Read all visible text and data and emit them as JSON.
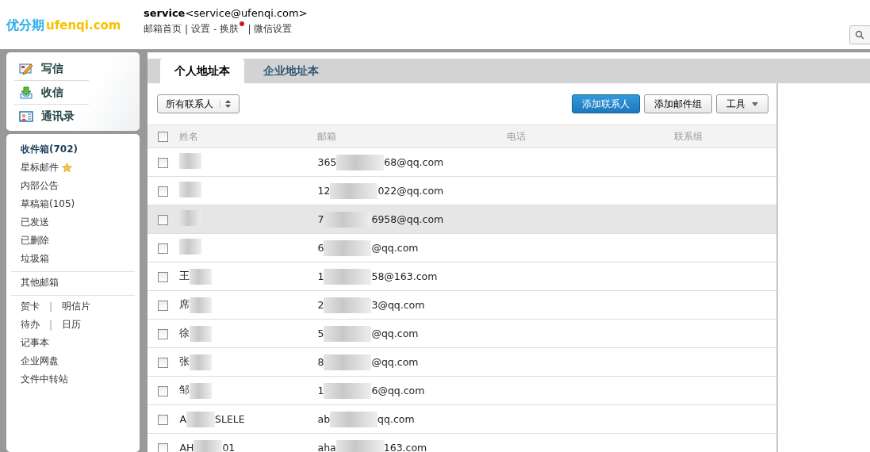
{
  "logo": {
    "name": "优分期",
    "domain": "ufenqi.com"
  },
  "account": {
    "user": "service",
    "address": "<service@ufenqi.com>"
  },
  "nav": [
    {
      "label": "邮箱首页",
      "sep": "|",
      "badge": false
    },
    {
      "label": "设置",
      "sep": "-",
      "badge": false
    },
    {
      "label": "换肤",
      "sep": "|",
      "badge": true
    },
    {
      "label": "微信设置",
      "badge": false
    }
  ],
  "quick_actions": [
    {
      "kind": "compose",
      "label": "写信"
    },
    {
      "kind": "receive",
      "label": "收信"
    },
    {
      "kind": "contacts",
      "label": "通讯录"
    }
  ],
  "folder_groups": [
    [
      {
        "label": "收件箱(702)",
        "selected": true,
        "starred": false
      },
      {
        "label": "星标邮件",
        "selected": false,
        "starred": true
      },
      {
        "label": "内部公告",
        "selected": false,
        "starred": false
      },
      {
        "label": "草稿箱(105)",
        "selected": false,
        "starred": false
      },
      {
        "label": "已发送",
        "selected": false,
        "starred": false
      },
      {
        "label": "已删除",
        "selected": false,
        "starred": false
      },
      {
        "label": "垃圾箱",
        "selected": false,
        "starred": false
      }
    ],
    [
      {
        "label": "其他邮箱",
        "selected": false,
        "starred": false
      }
    ],
    [
      {
        "links": [
          "贺卡",
          "明信片"
        ],
        "sep": "|"
      },
      {
        "links": [
          "待办",
          "日历"
        ],
        "sep": "|"
      },
      {
        "label": "记事本",
        "selected": false,
        "starred": false
      },
      {
        "label": "企业网盘",
        "selected": false,
        "starred": false
      },
      {
        "label": "文件中转站",
        "selected": false,
        "starred": false
      }
    ]
  ],
  "tabs": [
    {
      "label": "个人地址本",
      "selected": true
    },
    {
      "label": "企业地址本",
      "selected": false
    }
  ],
  "filter": {
    "label": "所有联系人"
  },
  "buttons": [
    {
      "label": "添加联系人",
      "kind": "primary"
    },
    {
      "label": "添加邮件组",
      "kind": "plain"
    },
    {
      "label": "工具",
      "kind": "menu"
    }
  ],
  "table": {
    "select_all_checked": false,
    "columns": [
      "姓名",
      "邮箱",
      "电话",
      "联系组"
    ],
    "rows": [
      {
        "selected": false,
        "checked": false,
        "email_start": "365",
        "email_end": "68@qq.com"
      },
      {
        "selected": false,
        "checked": false,
        "email_start": "12",
        "email_end": "022@qq.com"
      },
      {
        "selected": true,
        "checked": false,
        "email_start": "7",
        "email_end": "6958@qq.com"
      },
      {
        "selected": false,
        "checked": false,
        "email_start": "6",
        "email_end": "@qq.com"
      },
      {
        "selected": false,
        "checked": false,
        "name_start": "王",
        "email_start": "1",
        "email_end": "58@163.com"
      },
      {
        "selected": false,
        "checked": false,
        "name_start": "席",
        "email_start": "2",
        "email_end": "3@qq.com"
      },
      {
        "selected": false,
        "checked": false,
        "name_start": "徐",
        "email_start": "5",
        "email_end": "@qq.com"
      },
      {
        "selected": false,
        "checked": false,
        "name_start": "张",
        "email_start": "8",
        "email_end": "@qq.com"
      },
      {
        "selected": false,
        "checked": false,
        "name_start": "邹",
        "email_start": "1",
        "email_end": "6@qq.com"
      },
      {
        "selected": false,
        "checked": false,
        "name_start": "A",
        "name_end": "SLELE",
        "email_start": "ab",
        "email_end": "qq.com"
      },
      {
        "selected": false,
        "checked": false,
        "name_start": "AH",
        "name_end": "01",
        "email_start": "aha",
        "email_end": "163.com"
      }
    ]
  }
}
